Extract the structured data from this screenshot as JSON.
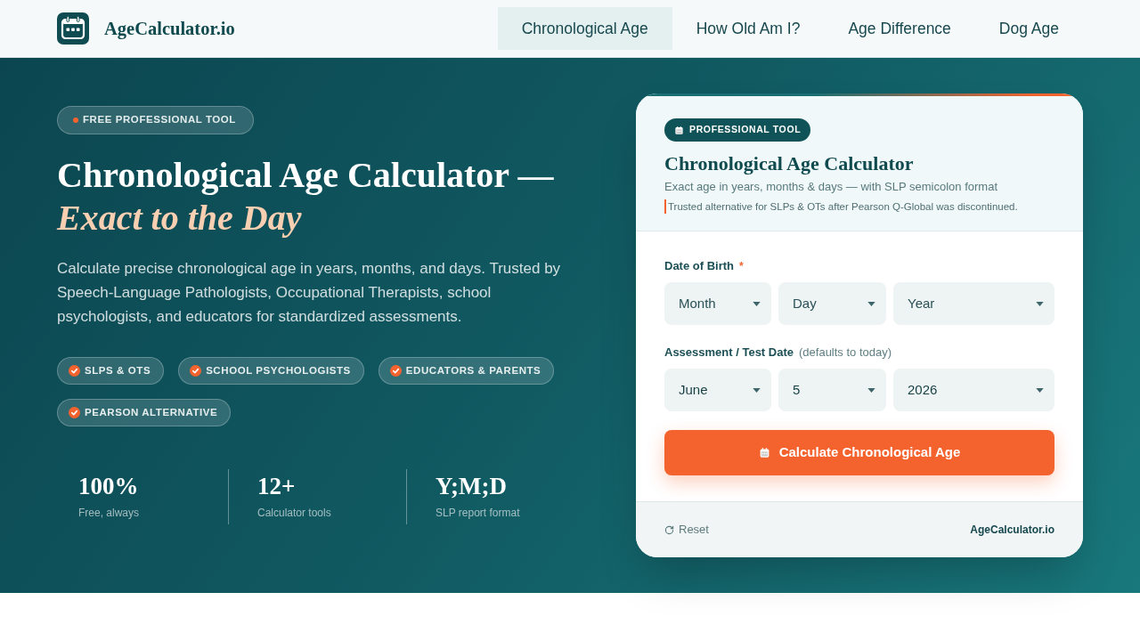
{
  "header": {
    "logo_text": "AgeCalculator.io",
    "nav": [
      {
        "label": "Chronological Age",
        "selected": true
      },
      {
        "label": "How Old Am I?",
        "selected": false
      },
      {
        "label": "Age Difference",
        "selected": false
      },
      {
        "label": "Dog Age",
        "selected": false
      }
    ]
  },
  "hero": {
    "badge": "FREE PROFESSIONAL TOOL",
    "title": "Chronological Age Calculator —",
    "title_accent": "Exact to the Day",
    "description": "Calculate precise chronological age in years, months, and days. Trusted by Speech-Language Pathologists, Occupational Therapists, school psychologists, and educators for standardized assessments.",
    "tags": [
      "SLPS & OTS",
      "SCHOOL PSYCHOLOGISTS",
      "EDUCATORS & PARENTS",
      "PEARSON ALTERNATIVE"
    ],
    "stats": [
      {
        "value": "100%",
        "label": "Free, always"
      },
      {
        "value": "12+",
        "label": "Calculator tools"
      },
      {
        "value": "Y;M;D",
        "label": "SLP report format"
      }
    ]
  },
  "calculator": {
    "badge": "PROFESSIONAL TOOL",
    "title": "Chronological Age Calculator",
    "subtitle": "Exact age in years, months & days — with SLP semicolon format",
    "note": "Trusted alternative for SLPs & OTs after Pearson Q-Global was discontinued.",
    "fields": [
      {
        "label": "Date of Birth",
        "required_mark": "*",
        "selects": [
          {
            "placeholder": "Month"
          },
          {
            "placeholder": "Day"
          },
          {
            "placeholder": "Year"
          }
        ]
      },
      {
        "label": "Assessment / Test Date",
        "hint": "(defaults to today)",
        "selects": [
          {
            "value": "June"
          },
          {
            "value": "5"
          },
          {
            "value": "2026"
          }
        ]
      }
    ],
    "button": "Calculate Chronological Age",
    "reset": "Reset",
    "brand": "AgeCalculator.io"
  }
}
